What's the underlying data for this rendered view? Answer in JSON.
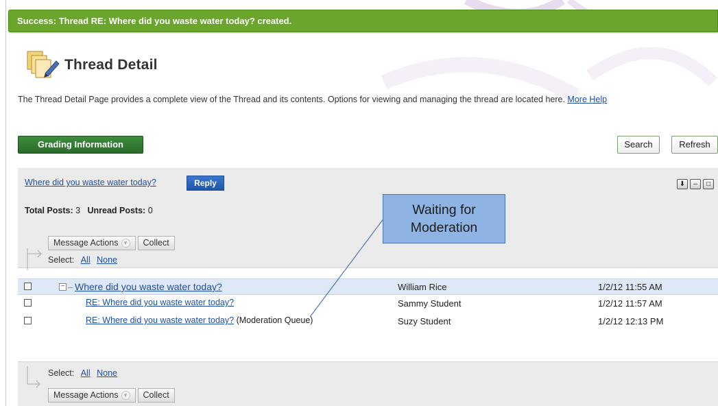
{
  "success_message": "Success: Thread RE: Where did you waste water today? created.",
  "page": {
    "title": "Thread Detail",
    "description": "The Thread Detail Page provides a complete view of the Thread and its contents. Options for viewing and managing the thread are located here.",
    "more_help": "More Help"
  },
  "toolbar": {
    "grading_label": "Grading Information",
    "search_label": "Search",
    "refresh_label": "Refresh"
  },
  "thread": {
    "title_link": "Where did you waste water today?",
    "reply_label": "Reply",
    "total_posts_label": "Total Posts:",
    "total_posts_value": "3",
    "unread_posts_label": "Unread Posts:",
    "unread_posts_value": "0"
  },
  "actions": {
    "message_actions_label": "Message Actions",
    "collect_label": "Collect",
    "select_label": "Select:",
    "all_label": "All",
    "none_label": "None"
  },
  "posts": [
    {
      "title": "Where did you waste water today?",
      "suffix": "",
      "author": "William Rice",
      "date": "1/2/12 11:55 AM"
    },
    {
      "title": "RE: Where did you waste water today?",
      "suffix": "",
      "author": "Sammy Student",
      "date": "1/2/12 11:57 AM"
    },
    {
      "title": "RE: Where did you waste water today?",
      "suffix": "(Moderation Queue)",
      "author": "Suzy Student",
      "date": "1/2/12 12:13 PM"
    }
  ],
  "callout": {
    "line1": "Waiting for",
    "line2": "Moderation"
  },
  "colors": {
    "success_green": "#6aa62b",
    "grading_green": "#2f7a2f",
    "reply_blue": "#1f56a8",
    "callout_blue": "#8eb4e3",
    "link_blue": "#1e4fa8"
  },
  "icons": [
    "thread-detail-icon",
    "expand-all-icon",
    "collapse-all-icon",
    "window-icon",
    "collapse-tree-icon",
    "chevron-down-icon"
  ]
}
